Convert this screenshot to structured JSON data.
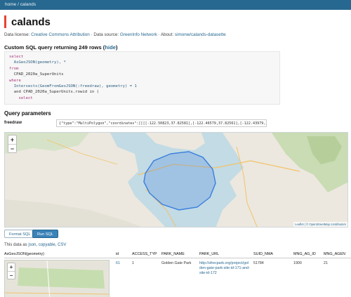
{
  "breadcrumb": {
    "home": "home",
    "separator": " / ",
    "current": "calands"
  },
  "page_title": "calands",
  "license": {
    "prefix": "Data license: ",
    "license_link": "Creative Commons Attribution",
    "source_prefix": " · Data source: ",
    "source_link": "GreenInfo Network",
    "about_prefix": " · About: ",
    "about_link": "simonw/calands-datasette"
  },
  "sql": {
    "heading": "Custom SQL query returning 249 rows",
    "toggle_label": "hide",
    "lines": [
      {
        "kw": "select",
        "rest": ""
      },
      {
        "kw": "",
        "rest": "  AsGeoJSON(geometry), *"
      },
      {
        "kw": "from",
        "rest": ""
      },
      {
        "kw": "",
        "rest": "  CPAD_2020a_SuperUnits"
      },
      {
        "kw": "where",
        "rest": ""
      },
      {
        "kw": "",
        "rest": "  Intersects(GeomFromGeoJSON(:freedraw), geometry) = 1"
      },
      {
        "kw": "",
        "rest": "  and CPAD_2020a_SuperUnits.rowid in ("
      },
      {
        "kw": "",
        "rest": "    select"
      }
    ]
  },
  "params": {
    "heading": "Query parameters",
    "freedraw_label": "freedraw",
    "freedraw_value": "{\"type\":\"MultiPolygon\",\"coordinates\":[[[[-122.50823,37.82581],[-122.46579,37.82561],[-122.43979,37.81018],[-122.39856,37.80114]"
  },
  "map": {
    "zoom_in": "+",
    "zoom_out": "−",
    "attribution_leaflet": "Leaflet",
    "attribution_osm": " | © OpenStreetMap contributors"
  },
  "buttons": {
    "format_sql": "Format SQL",
    "run_sql": "Run SQL"
  },
  "data_note": {
    "prefix": "This data as ",
    "json": "json",
    "sep1": ", ",
    "copyable": "copyable",
    "sep2": ", ",
    "csv": "CSV"
  },
  "table": {
    "headers": [
      "AsGeoJSON(geometry)",
      "id",
      "ACCESS_TYP",
      "PARK_NAME",
      "PARK_URL",
      "SUID_NMA",
      "MNG_AG_ID",
      "MNG_AGEN"
    ],
    "rows": [
      {
        "id": "61",
        "access": "1",
        "park_name": "Golden Gate Park",
        "park_url": "http://sfrecpark.org/project/golden-gate-park-site-id-171-and-site-id-172",
        "suid": "51784",
        "mng_ag_id": "1900",
        "mng_agen": "21"
      }
    ]
  },
  "colors": {
    "topbar": "#276890",
    "accent": "#e8432e",
    "link": "#276890",
    "polygon": "#3a7dde"
  }
}
